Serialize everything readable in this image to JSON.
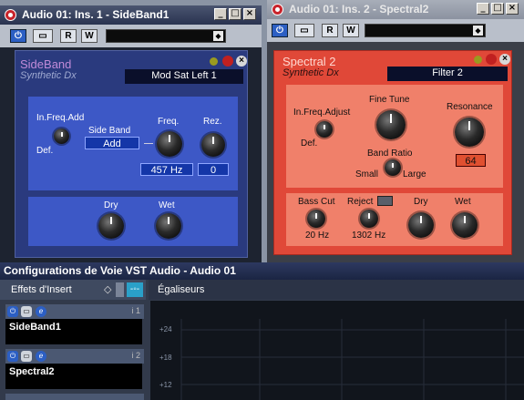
{
  "window1": {
    "title": "Audio 01: Ins. 1 - SideBand1",
    "controls": {
      "minimize": "_",
      "maximize": "□",
      "close": "×"
    },
    "toolbar": {
      "power": "⏻",
      "bypass": "▭",
      "read": "R",
      "write": "W"
    },
    "plugin": {
      "name": "SideBand",
      "subtitle": "Synthetic Dx",
      "preset": "Mod Sat Left 1",
      "in_freq_add_label": "In.Freq.Add",
      "def_label": "Def.",
      "side_band_label": "Side Band",
      "side_band_value": "Add",
      "freq_label": "Freq.",
      "freq_value": "457 Hz",
      "res_label": "Rez.",
      "res_value": "0",
      "dry_label": "Dry",
      "wet_label": "Wet"
    }
  },
  "window2": {
    "title": "Audio 01: Ins. 2 - Spectral2",
    "controls": {
      "minimize": "_",
      "maximize": "□",
      "close": "×"
    },
    "toolbar": {
      "power": "⏻",
      "bypass": "▭",
      "read": "R",
      "write": "W"
    },
    "plugin": {
      "name": "Spectral 2",
      "subtitle": "Synthetic Dx",
      "preset": "Filter 2",
      "in_freq_adjust_label": "In.Freq.Adjust",
      "def_label": "Def.",
      "fine_tune_label": "Fine Tune",
      "band_ratio_label": "Band Ratio",
      "small_label": "Small",
      "large_label": "Large",
      "resonance_label": "Resonance",
      "resonance_value": "64",
      "bass_cut_label": "Bass Cut",
      "bass_cut_value": "20 Hz",
      "reject_label": "Reject",
      "reject_value": "1302 Hz",
      "dry_label": "Dry",
      "wet_label": "Wet"
    }
  },
  "channel_config": {
    "title": "Configurations de Voie VST Audio - Audio 01",
    "inserts_label": "Effets d'Insert",
    "eq_label": "Égaliseurs",
    "slots": [
      {
        "number": "i 1",
        "name": "SideBand1"
      },
      {
        "number": "i 2",
        "name": "Spectral2"
      },
      {
        "number": "i 3",
        "name": ""
      }
    ],
    "eq_scale": [
      "+24",
      "+18",
      "+12"
    ]
  },
  "colors": {
    "sideband_panel": "#2a3a7e",
    "spectral_panel": "#e04838",
    "title_active": "#2a3350"
  }
}
